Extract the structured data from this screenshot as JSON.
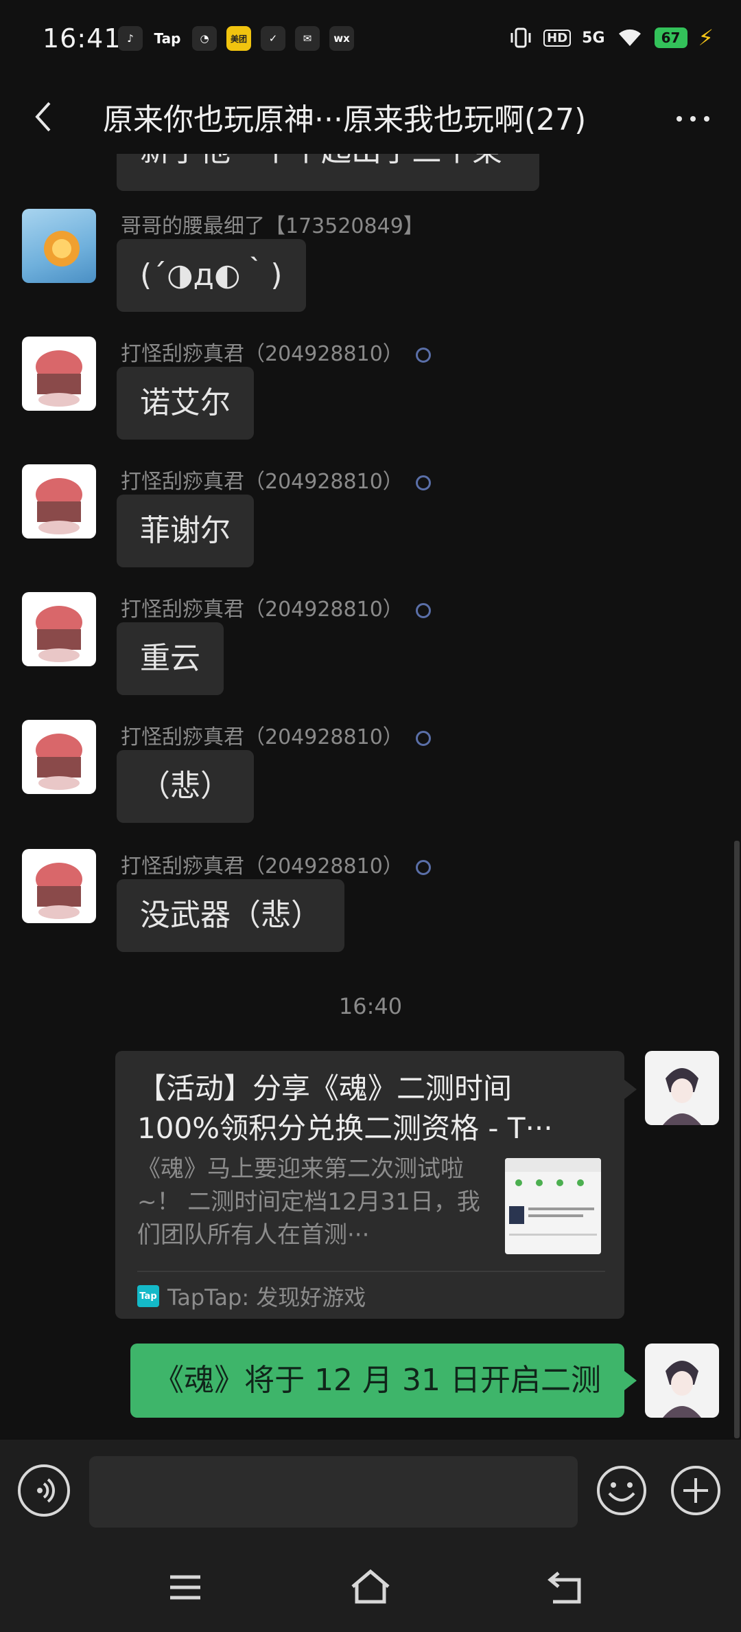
{
  "status_bar": {
    "time": "16:41",
    "apps": [
      "♪",
      "Tap",
      "◔",
      "美团",
      "✓",
      "✉",
      "wx"
    ],
    "signal": "5G",
    "hd": "HD",
    "battery": "67"
  },
  "header": {
    "title": "原来你也玩原神···原来我也玩啊(27)"
  },
  "chat": {
    "partial_top_text": "新了他一个个起出了三个東",
    "messages": [
      {
        "sender": "哥哥的腰最细了【173520849】",
        "text": "(´◑д◐｀)"
      },
      {
        "sender": "打怪刮痧真君（204928810）",
        "text": "诺艾尔"
      },
      {
        "sender": "打怪刮痧真君（204928810）",
        "text": "菲谢尔"
      },
      {
        "sender": "打怪刮痧真君（204928810）",
        "text": "重云"
      },
      {
        "sender": "打怪刮痧真君（204928810）",
        "text": "（悲）"
      },
      {
        "sender": "打怪刮痧真君（204928810）",
        "text": "没武器（悲）"
      }
    ],
    "timestamp": "16:40",
    "share_card": {
      "title_line1": "【活动】分享《魂》二测时间",
      "title_line2": "100%领积分兑换二测资格 - T···",
      "description": "《魂》马上要迎来第二次测试啦~！ 二测时间定档12月31日，我们团队所有人在首测···",
      "source_badge": "Tap",
      "source": "TapTap: 发现好游戏"
    },
    "self_message": "《魂》将于 12 月 31 日开启二测"
  },
  "input_bar": {
    "placeholder": ""
  },
  "colors": {
    "background": "#111111",
    "bubble_other": "#2c2c2c",
    "bubble_self": "#3eb56a",
    "online_dot": "#5a6fa8"
  }
}
